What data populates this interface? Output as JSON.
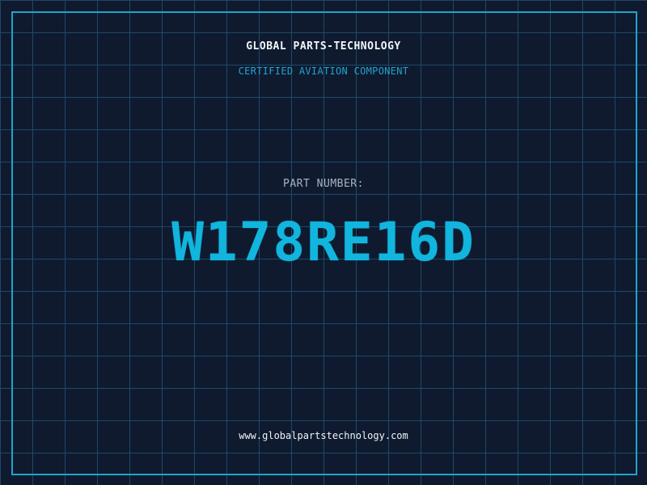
{
  "header": {
    "company": "GLOBAL PARTS-TECHNOLOGY",
    "tagline": "CERTIFIED AVIATION COMPONENT"
  },
  "part": {
    "label": "PART NUMBER:",
    "number": "W178RE16D"
  },
  "footer": {
    "website": "www.globalpartstechnology.com"
  },
  "colors": {
    "background": "#0f1a2f",
    "grid": "#1d4a66",
    "accent": "#21a3cc",
    "part_number": "#11b5dd",
    "text": "#f2f5f8",
    "muted": "#a9b3c4"
  }
}
